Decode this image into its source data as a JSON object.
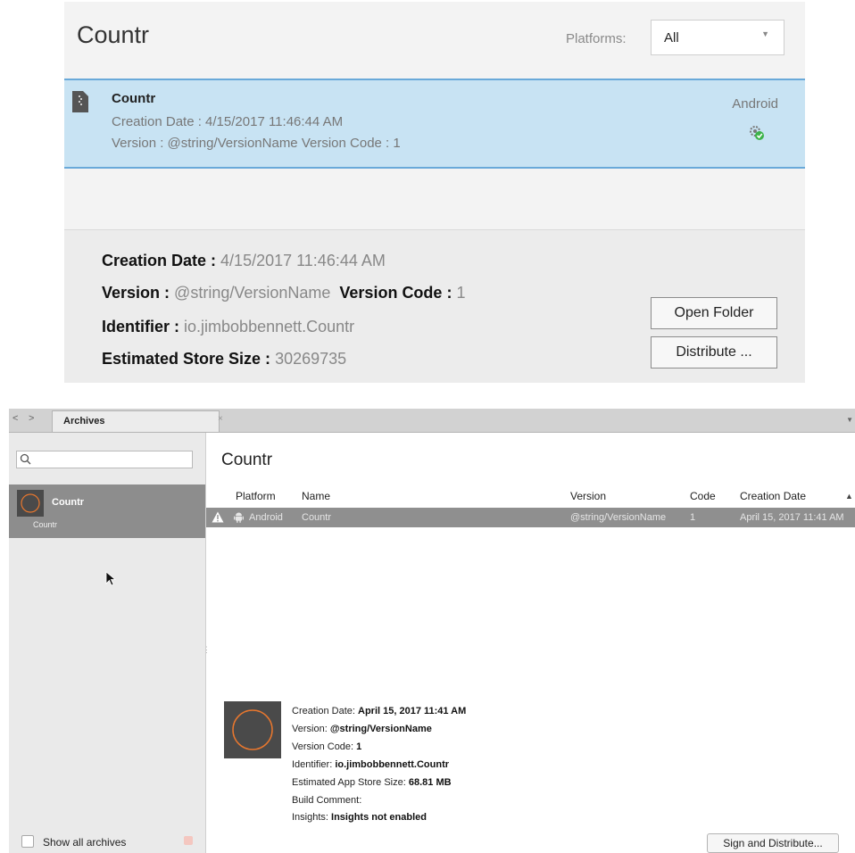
{
  "windows_panel": {
    "title": "Countr",
    "platforms_label": "Platforms:",
    "platforms_value": "All",
    "archive_row": {
      "name": "Countr",
      "creation_date": "Creation Date :  4/15/2017 11:46:44 AM",
      "version_line": "Version :  @string/VersionName    Version Code :  1",
      "platform": "Android"
    },
    "details": {
      "creation_date_label": "Creation Date :",
      "creation_date_value": "4/15/2017 11:46:44 AM",
      "version_label": "Version :",
      "version_value": "@string/VersionName",
      "version_code_label": "Version Code :",
      "version_code_value": "1",
      "identifier_label": "Identifier :",
      "identifier_value": "io.jimbobbennett.Countr",
      "store_size_label": "Estimated Store Size :",
      "store_size_value": "30269735"
    },
    "buttons": {
      "open_folder": "Open Folder",
      "distribute": "Distribute ..."
    }
  },
  "mac_panel": {
    "tab_label": "Archives",
    "tab_close": "×",
    "sidebar": {
      "search_placeholder": "",
      "item_name": "Countr",
      "item_sub": "Countr",
      "show_all_label": "Show all archives"
    },
    "main": {
      "title": "Countr",
      "columns": {
        "platform": "Platform",
        "name": "Name",
        "version": "Version",
        "code": "Code",
        "creation_date": "Creation Date"
      },
      "row": {
        "platform": "Android",
        "name": "Countr",
        "version": "@string/VersionName",
        "code": "1",
        "creation_date": "April 15, 2017 11:41 AM"
      },
      "details": {
        "creation_date_label": "Creation Date:",
        "creation_date_value": "April 15, 2017 11:41 AM",
        "version_label": "Version:",
        "version_value": "@string/VersionName",
        "version_code_label": "Version Code:",
        "version_code_value": "1",
        "identifier_label": "Identifier:",
        "identifier_value": "io.jimbobbennett.Countr",
        "store_size_label": "Estimated App Store Size:",
        "store_size_value": "68.81 MB",
        "build_comment_label": "Build Comment:",
        "insights_label": "Insights:",
        "insights_value": "Insights not enabled"
      },
      "sign_button": "Sign and Distribute..."
    }
  },
  "colors": {
    "selected_row_blue": "#c8e3f3",
    "selected_row_border": "#69a9d9",
    "mac_selected_gray": "#8f8f8f",
    "android_green": "#3db34a"
  },
  "icons": [
    "file-zip-icon",
    "android-gear-icon",
    "search-icon",
    "warning-icon",
    "android-icon",
    "cursor-icon"
  ]
}
